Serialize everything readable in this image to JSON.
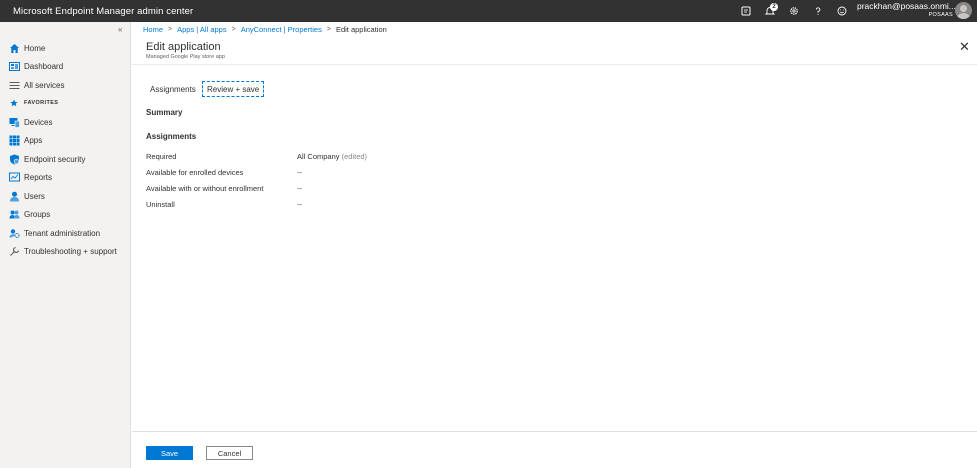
{
  "app": {
    "title": "Microsoft Endpoint Manager admin center"
  },
  "user": {
    "email": "prackhan@posaas.onmi...",
    "tenant": "POSAAS"
  },
  "topbar": {
    "notification_count": "2"
  },
  "sidebar": {
    "collapse": "«",
    "items": [
      {
        "label": "Home",
        "icon": "home-icon"
      },
      {
        "label": "Dashboard",
        "icon": "dashboard-icon"
      },
      {
        "label": "All services",
        "icon": "list-icon"
      },
      {
        "label": "FAVORITES",
        "icon": "star-icon"
      },
      {
        "label": "Devices",
        "icon": "devices-icon"
      },
      {
        "label": "Apps",
        "icon": "apps-grid-icon"
      },
      {
        "label": "Endpoint security",
        "icon": "shield-icon"
      },
      {
        "label": "Reports",
        "icon": "reports-icon"
      },
      {
        "label": "Users",
        "icon": "user-icon"
      },
      {
        "label": "Groups",
        "icon": "groups-icon"
      },
      {
        "label": "Tenant administration",
        "icon": "tenant-admin-icon"
      },
      {
        "label": "Troubleshooting + support",
        "icon": "wrench-icon"
      }
    ]
  },
  "breadcrumb": {
    "items": [
      "Home",
      "Apps | All apps",
      "AnyConnect | Properties"
    ],
    "current": "Edit application",
    "separator": ">"
  },
  "page": {
    "title": "Edit application",
    "subtitle": "Managed Google Play store app",
    "close": "✕"
  },
  "tabs": [
    {
      "label": "Assignments"
    },
    {
      "label": "Review + save"
    }
  ],
  "summary": {
    "title": "Summary"
  },
  "assignments": {
    "title": "Assignments",
    "rows": [
      {
        "label": "Required",
        "value": "All Company",
        "note": "(edited)"
      },
      {
        "label": "Available for enrolled devices",
        "value": "--"
      },
      {
        "label": "Available with or without enrollment",
        "value": "--"
      },
      {
        "label": "Uninstall",
        "value": "--"
      }
    ]
  },
  "footer": {
    "save_label": "Save",
    "cancel_label": "Cancel"
  },
  "colors": {
    "accent": "#0078d4",
    "topbar": "#323232",
    "sidebar": "#f3f2f1"
  }
}
